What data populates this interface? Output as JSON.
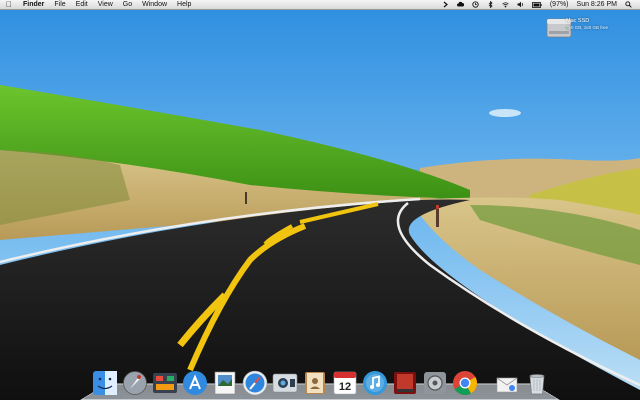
{
  "menubar": {
    "app_name": "Finder",
    "menus": [
      "File",
      "Edit",
      "View",
      "Go",
      "Window",
      "Help"
    ],
    "battery_text": "(97%)",
    "clock": "Sun 8:26 PM"
  },
  "desktop": {
    "drive": {
      "name": "Mac SSD",
      "info": "250 GB, 160 GB free"
    }
  },
  "dock": {
    "apps": [
      "finder",
      "launchpad",
      "mission-control",
      "app-store",
      "preview",
      "safari",
      "facetime",
      "contacts",
      "calendar",
      "itunes",
      "photo-booth",
      "system-preferences",
      "chrome"
    ],
    "calendar_day": "12",
    "right_items": [
      "mail-stack",
      "trash"
    ]
  }
}
